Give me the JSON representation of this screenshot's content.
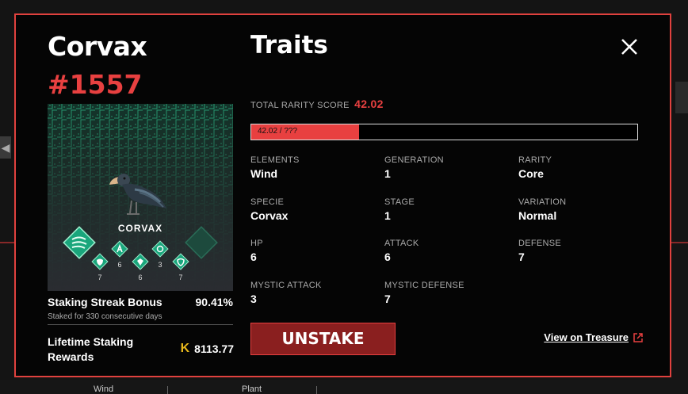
{
  "background": {
    "bottom_labels": [
      "Wind",
      "Plant"
    ]
  },
  "modal": {
    "name": "Corvax",
    "token_id": "#1557",
    "card": {
      "creature_name": "CORVAX",
      "stats": [
        "7",
        "6",
        "6",
        "3",
        "7"
      ]
    },
    "staking": {
      "streak_label": "Staking Streak Bonus",
      "streak_value": "90.41%",
      "streak_sub": "Staked for 330 consecutive days",
      "lifetime_label": "Lifetime Staking Rewards",
      "lifetime_value": "8113.77"
    },
    "traits_title": "Traits",
    "rarity": {
      "label": "TOTAL RARITY SCORE",
      "score": "42.02",
      "bar_text": "42.02 / ???",
      "bar_fraction": 0.28
    },
    "traits": [
      {
        "key": "ELEMENTS",
        "value": "Wind"
      },
      {
        "key": "GENERATION",
        "value": "1"
      },
      {
        "key": "RARITY",
        "value": "Core"
      },
      {
        "key": "SPECIE",
        "value": "Corvax"
      },
      {
        "key": "STAGE",
        "value": "1"
      },
      {
        "key": "VARIATION",
        "value": "Normal"
      },
      {
        "key": "HP",
        "value": "6"
      },
      {
        "key": "ATTACK",
        "value": "6"
      },
      {
        "key": "DEFENSE",
        "value": "7"
      },
      {
        "key": "MYSTIC ATTACK",
        "value": "3"
      },
      {
        "key": "MYSTIC DEFENSE",
        "value": "7"
      }
    ],
    "unstake_label": "UNSTAKE",
    "treasure_link": "View on Treasure",
    "colors": {
      "accent": "#e84040",
      "border": "#e0413e",
      "gold": "#e8b81c"
    }
  }
}
